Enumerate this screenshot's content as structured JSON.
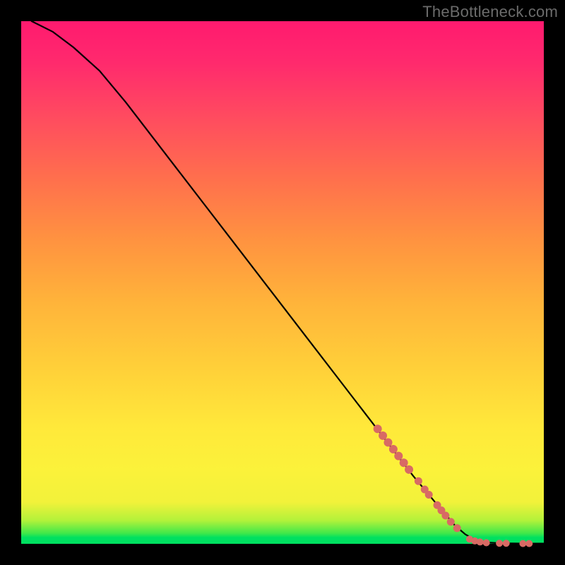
{
  "watermark": "TheBottleneck.com",
  "colors": {
    "background": "#000000",
    "curve": "#000000",
    "marker": "#d86a64",
    "plot_border": "#000000"
  },
  "chart_data": {
    "type": "line",
    "title": "",
    "xlabel": "",
    "ylabel": "",
    "xlim": [
      0,
      100
    ],
    "ylim": [
      0,
      100
    ],
    "grid": false,
    "curve": [
      {
        "x": 2,
        "y": 100
      },
      {
        "x": 6,
        "y": 98
      },
      {
        "x": 10,
        "y": 95
      },
      {
        "x": 15,
        "y": 90.5
      },
      {
        "x": 20,
        "y": 84.5
      },
      {
        "x": 25,
        "y": 78
      },
      {
        "x": 30,
        "y": 71.5
      },
      {
        "x": 35,
        "y": 65
      },
      {
        "x": 40,
        "y": 58.5
      },
      {
        "x": 45,
        "y": 52
      },
      {
        "x": 50,
        "y": 45.5
      },
      {
        "x": 55,
        "y": 39
      },
      {
        "x": 60,
        "y": 32.5
      },
      {
        "x": 65,
        "y": 26
      },
      {
        "x": 70,
        "y": 19.5
      },
      {
        "x": 75,
        "y": 13
      },
      {
        "x": 80,
        "y": 7
      },
      {
        "x": 83,
        "y": 3.5
      },
      {
        "x": 85,
        "y": 1.8
      },
      {
        "x": 87,
        "y": 0.7
      },
      {
        "x": 89,
        "y": 0.25
      },
      {
        "x": 92,
        "y": 0.1
      },
      {
        "x": 96,
        "y": 0.05
      },
      {
        "x": 100,
        "y": 0.05
      }
    ],
    "markers": [
      {
        "x": 68.2,
        "y": 22.0,
        "r": 5.5
      },
      {
        "x": 69.2,
        "y": 20.7,
        "r": 5.5
      },
      {
        "x": 70.2,
        "y": 19.4,
        "r": 5.5
      },
      {
        "x": 71.2,
        "y": 18.1,
        "r": 5.5
      },
      {
        "x": 72.2,
        "y": 16.8,
        "r": 5.5
      },
      {
        "x": 73.2,
        "y": 15.5,
        "r": 5.5
      },
      {
        "x": 74.2,
        "y": 14.2,
        "r": 5.5
      },
      {
        "x": 76.0,
        "y": 12.0,
        "r": 5.0
      },
      {
        "x": 77.2,
        "y": 10.4,
        "r": 5.0
      },
      {
        "x": 78.0,
        "y": 9.4,
        "r": 5.0
      },
      {
        "x": 79.6,
        "y": 7.4,
        "r": 5.0
      },
      {
        "x": 80.4,
        "y": 6.4,
        "r": 5.0
      },
      {
        "x": 81.2,
        "y": 5.4,
        "r": 5.0
      },
      {
        "x": 82.2,
        "y": 4.2,
        "r": 5.0
      },
      {
        "x": 83.4,
        "y": 3.0,
        "r": 5.0
      },
      {
        "x": 85.8,
        "y": 0.9,
        "r": 4.5
      },
      {
        "x": 86.8,
        "y": 0.55,
        "r": 4.5
      },
      {
        "x": 87.8,
        "y": 0.35,
        "r": 4.5
      },
      {
        "x": 89.0,
        "y": 0.2,
        "r": 4.5
      },
      {
        "x": 91.5,
        "y": 0.1,
        "r": 4.5
      },
      {
        "x": 92.8,
        "y": 0.1,
        "r": 4.5
      },
      {
        "x": 96.0,
        "y": 0.05,
        "r": 4.5
      },
      {
        "x": 97.2,
        "y": 0.05,
        "r": 4.5
      }
    ]
  }
}
